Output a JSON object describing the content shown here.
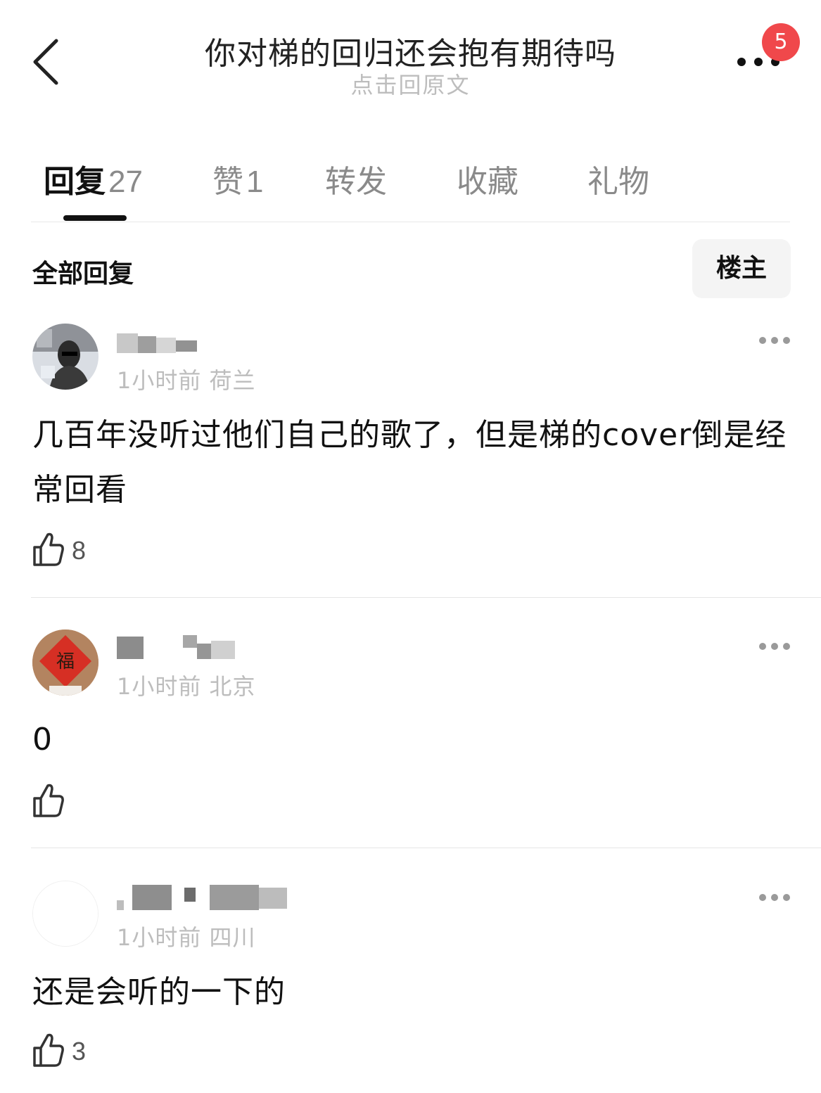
{
  "header": {
    "title": "你对梯的回归还会抱有期待吗",
    "subtitle": "点击回原文",
    "notification_badge": "5"
  },
  "tabs": [
    {
      "label": "回复",
      "count": "27",
      "active": true
    },
    {
      "label": "赞",
      "count": "1"
    },
    {
      "label": "转发",
      "count": ""
    },
    {
      "label": "收藏",
      "count": ""
    },
    {
      "label": "礼物",
      "count": ""
    }
  ],
  "filter": {
    "label": "全部回复",
    "op_button": "楼主"
  },
  "comments": [
    {
      "time": "1小时前",
      "location": "荷兰",
      "text": "几百年没听过他们自己的歌了，但是梯的cover倒是经常回看",
      "likes": "8"
    },
    {
      "time": "1小时前",
      "location": "北京",
      "text": "0",
      "likes": ""
    },
    {
      "time": "1小时前",
      "location": "四川",
      "text": "还是会听的一下的",
      "likes": "3"
    }
  ],
  "colors": {
    "badge": "#f0484b",
    "muted_text": "#bdbdbd",
    "primary_text": "#111111"
  },
  "icons": [
    "back-arrow-icon",
    "more-dots-icon",
    "thumbs-up-icon",
    "comment-more-icon"
  ]
}
